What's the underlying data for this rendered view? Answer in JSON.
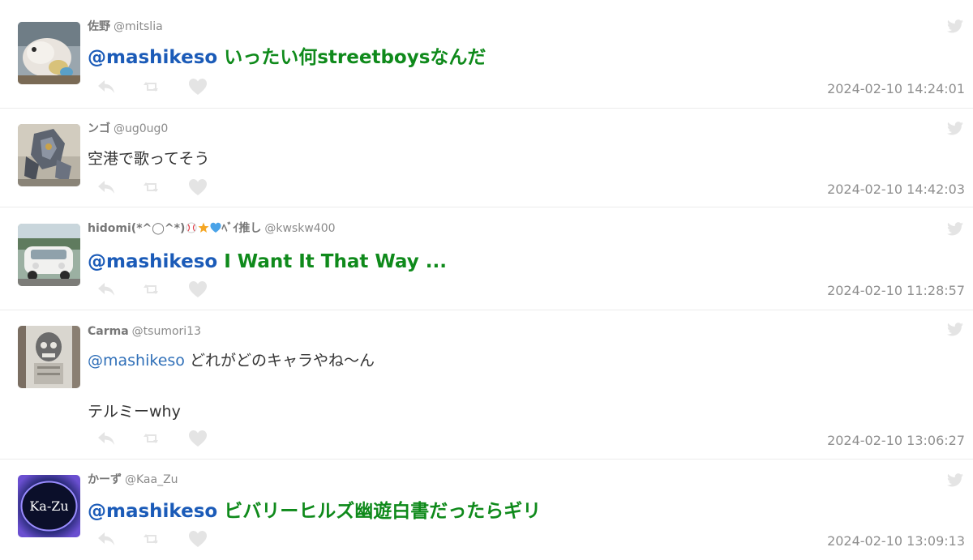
{
  "colors": {
    "mention": "#1b5bb8",
    "highlight_text": "#0f8a1b",
    "muted": "#8f8f8f",
    "icon": "#e4e4e4"
  },
  "tweets": [
    {
      "display_name": "佐野",
      "handle": "@mitslia",
      "mention": "@mashikeso",
      "text": "いったい何streetboysなんだ",
      "timestamp": "2024-02-10 14:24:01"
    },
    {
      "display_name": "ンゴ",
      "handle": "@ug0ug0",
      "mention": "",
      "text": "空港で歌ってそう",
      "timestamp": "2024-02-10 14:42:03"
    },
    {
      "display_name": "hidomi(*^◯^*)",
      "display_name_suffix": "ﾍﾞｲ推し",
      "handle": "@kwskw400",
      "mention": "@mashikeso",
      "text": "I Want It That Way ...",
      "timestamp": "2024-02-10 11:28:57"
    },
    {
      "display_name": "Carma",
      "handle": "@tsumori13",
      "mention": "@mashikeso",
      "text": "どれがどのキャラやね～ん",
      "text_line2": "テルミーwhy",
      "timestamp": "2024-02-10 13:06:27"
    },
    {
      "display_name": "かーず",
      "handle": "@Kaa_Zu",
      "mention": "@mashikeso",
      "text": "ビバリーヒルズ幽遊白書だったらギリ",
      "avatar_text": "Ka-Zu",
      "timestamp": "2024-02-10 13:09:13"
    }
  ],
  "icons": {
    "service": "twitter-bird-icon",
    "reply": "reply-icon",
    "retweet": "retweet-icon",
    "like": "heart-icon"
  }
}
